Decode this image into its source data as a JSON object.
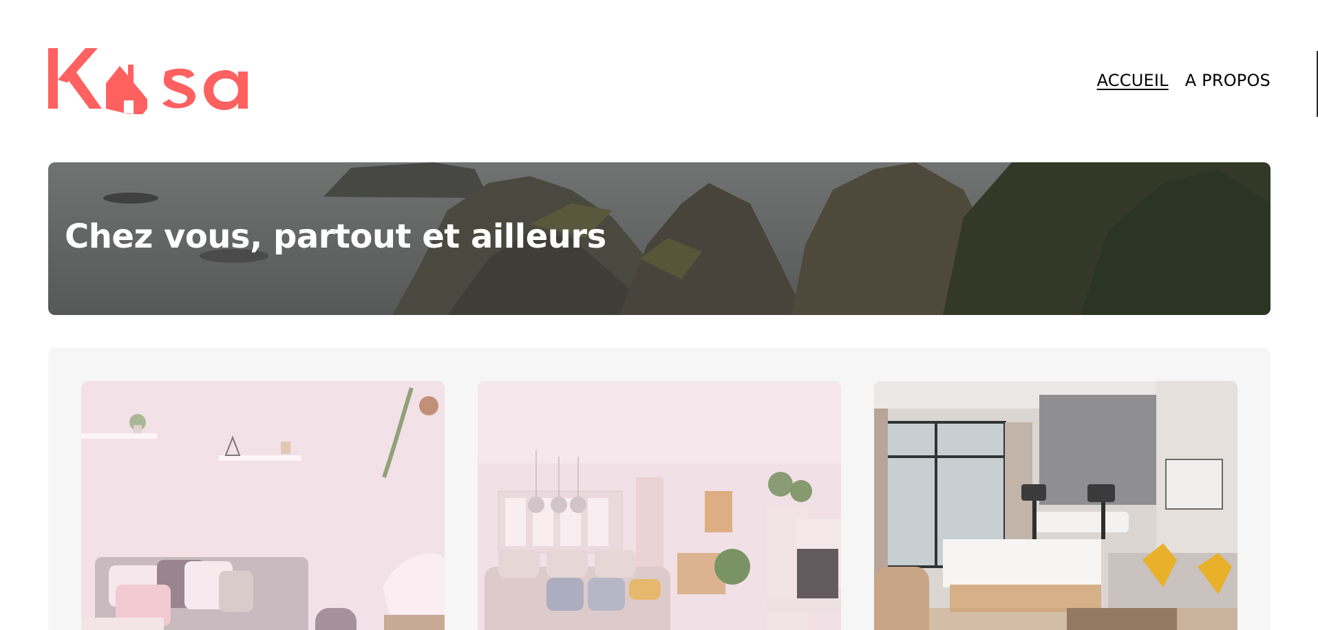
{
  "brand": {
    "name": "Kasa",
    "color": "#FF6060"
  },
  "nav": {
    "items": [
      {
        "label": "ACCUEIL",
        "active": true
      },
      {
        "label": "A PROPOS",
        "active": false
      }
    ]
  },
  "banner": {
    "title": "Chez vous, partout et ailleurs",
    "image": "coastal-cliffs-landscape"
  },
  "gallery": {
    "cards": [
      {
        "image": "white-living-room-with-shelves-and-sofa"
      },
      {
        "image": "bright-living-room-with-pendant-lamps"
      },
      {
        "image": "hotel-bedroom-with-large-window"
      }
    ]
  }
}
